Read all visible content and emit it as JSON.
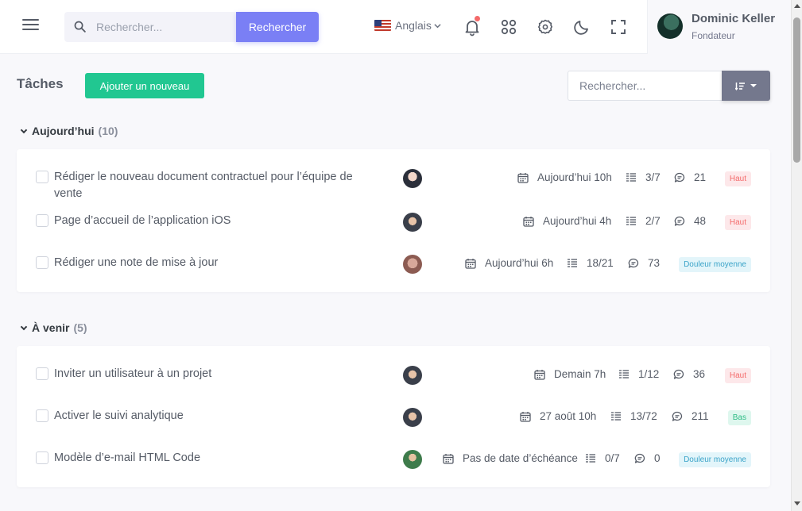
{
  "topbar": {
    "search": {
      "placeholder": "Rechercher...",
      "button_label": "Rechercher"
    },
    "language": {
      "label": "Anglais"
    },
    "notifications": {
      "has_unread": true
    },
    "user": {
      "name": "Dominic Keller",
      "role": "Fondateur"
    }
  },
  "page": {
    "title": "Tâches",
    "add_button_label": "Ajouter un nouveau",
    "search_placeholder": "Rechercher..."
  },
  "colors": {
    "primary": "#7a7ff5",
    "success": "#21c791",
    "danger": "#f46a6a",
    "info": "#3aa3c8",
    "secondary": "#74788d"
  },
  "sections": [
    {
      "label": "Aujourd’hui",
      "count": "(10)",
      "tasks": [
        {
          "title": "Rédiger le nouveau document contractuel pour l’équipe de vente",
          "due": "Aujourd’hui 10h",
          "subtasks": "3/7",
          "comments": "21",
          "priority": "Haut",
          "priority_level": "high"
        },
        {
          "title": "Page d’accueil de l’application iOS",
          "due": "Aujourd’hui 4h",
          "subtasks": "2/7",
          "comments": "48",
          "priority": "Haut",
          "priority_level": "high"
        },
        {
          "title": "Rédiger une note de mise à jour",
          "due": "Aujourd’hui 6h",
          "subtasks": "18/21",
          "comments": "73",
          "priority": "Douleur moyenne",
          "priority_level": "medium"
        }
      ]
    },
    {
      "label": "À venir",
      "count": "(5)",
      "tasks": [
        {
          "title": "Inviter un utilisateur à un projet",
          "due": "Demain 7h",
          "subtasks": "1/12",
          "comments": "36",
          "priority": "Haut",
          "priority_level": "high"
        },
        {
          "title": "Activer le suivi analytique",
          "due": "27 août 10h",
          "subtasks": "13/72",
          "comments": "211",
          "priority": "Bas",
          "priority_level": "low"
        },
        {
          "title": "Modèle d’e-mail HTML Code",
          "due": "Pas de date d’échéance",
          "subtasks": "0/7",
          "comments": "0",
          "priority": "Douleur moyenne",
          "priority_level": "medium"
        }
      ]
    }
  ]
}
